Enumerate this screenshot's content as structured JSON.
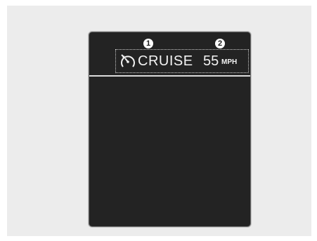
{
  "cluster": {
    "cruise_label": "CRUISE",
    "speed_value": "55",
    "speed_unit": "MPH",
    "cruise_icon": "cruise-control-icon"
  },
  "callouts": {
    "marker_1": "1",
    "marker_2": "2"
  },
  "colors": {
    "screen_background": "#232323",
    "text": "#f2f2f2",
    "page_background": "#ececec"
  }
}
